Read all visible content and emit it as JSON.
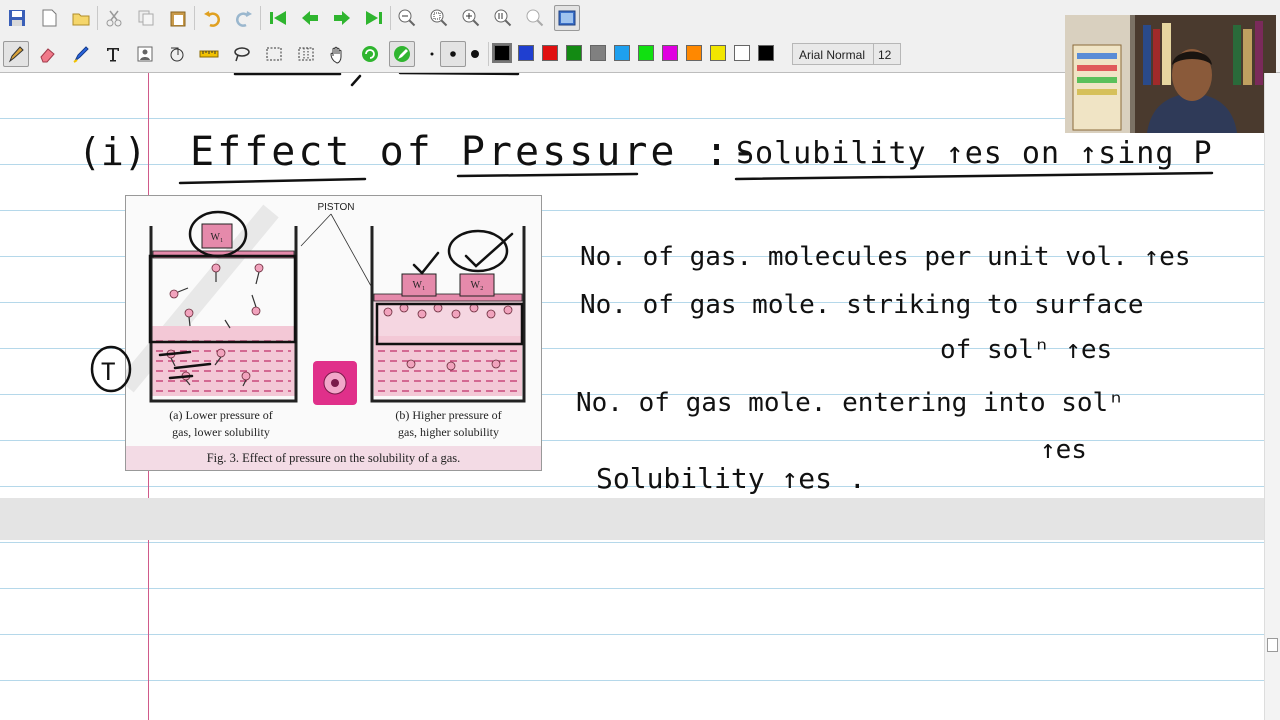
{
  "toolbar": {
    "font_name": "Arial Normal",
    "font_size": "12",
    "colors": [
      "#000000",
      "#1f3fd0",
      "#e01010",
      "#138a13",
      "#808080",
      "#1ea0ef",
      "#11e011",
      "#e000e0",
      "#ff8800",
      "#f2e600",
      "#ffffff",
      "#000000"
    ]
  },
  "figure": {
    "piston_label": "PISTON",
    "weight_1": "W₁",
    "weight_1b": "W₁",
    "weight_2": "W₂",
    "label_a_line1": "(a) Lower pressure of",
    "label_a_line2": "gas, lower solubility",
    "label_b_line1": "(b) Higher pressure of",
    "label_b_line2": "gas, higher solubility",
    "caption": "Fig. 3. Effect of pressure on the solubility of a gas."
  },
  "handwriting": {
    "heading_number": "(i)",
    "heading": "Effect of Pressure :-",
    "heading_rule": "Solubility ↑es on ↑sing P",
    "line1": "No. of gas. molecules per unit vol. ↑es",
    "line2": "No. of gas mole. striking to surface",
    "line3": "of solⁿ ↑es",
    "line4": "No. of gas mole. entering into solⁿ",
    "line5": "↑es",
    "line6": "Solubility ↑es .",
    "circled_mark": "T"
  }
}
